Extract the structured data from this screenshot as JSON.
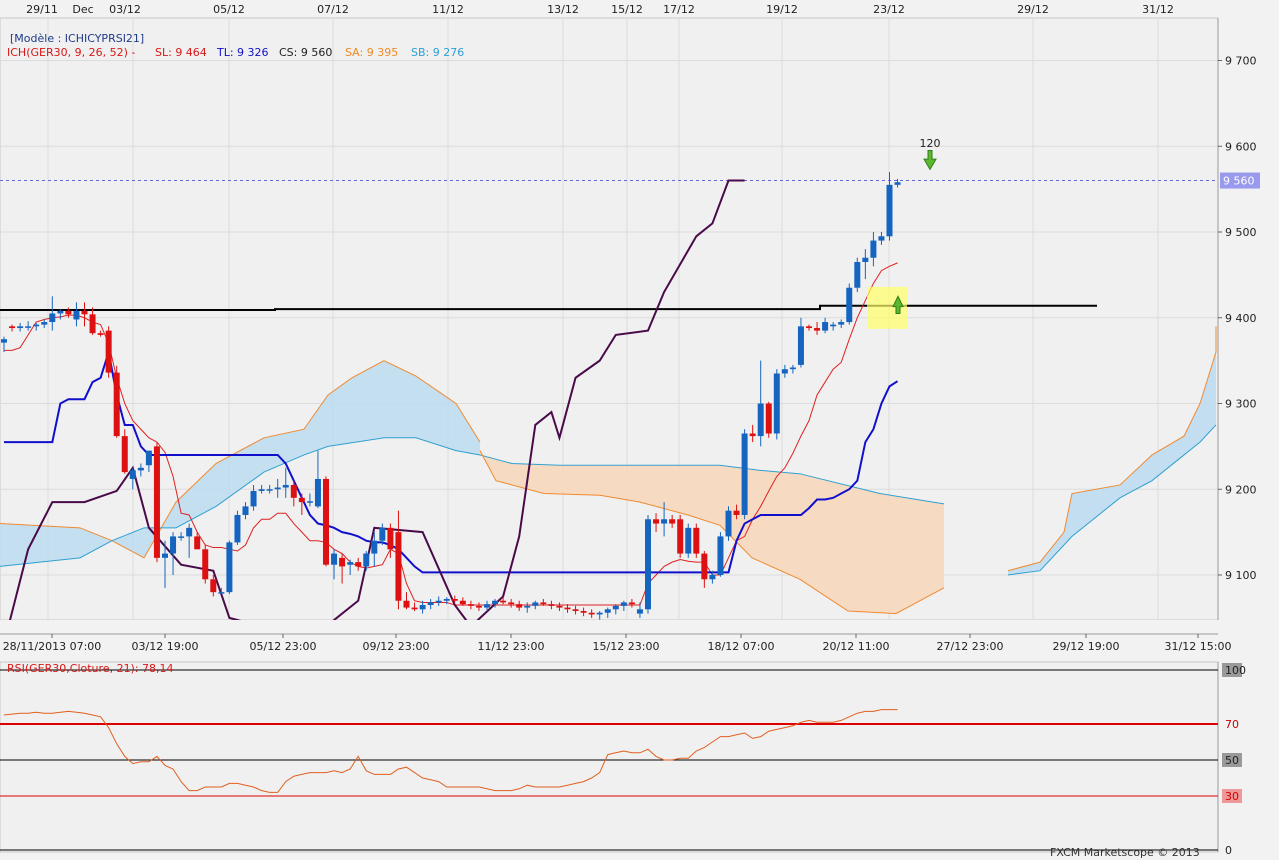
{
  "top_date_labels": [
    "29/11",
    "Dec",
    "03/12",
    "05/12",
    "07/12",
    "11/12",
    "13/12",
    "15/12",
    "17/12",
    "19/12",
    "23/12",
    "29/12",
    "31/12"
  ],
  "bottom_date_labels": [
    "28/11/2013 07:00",
    "03/12 19:00",
    "05/12 23:00",
    "09/12 23:00",
    "11/12 23:00",
    "15/12 23:00",
    "18/12 07:00",
    "20/12 11:00",
    "27/12 23:00",
    "29/12 19:00",
    "31/12 15:00"
  ],
  "legend": {
    "model": "[Modèle : ICHICYPRSI21]",
    "ich": "ICH(GER30, 9, 26, 52) -",
    "sl": "SL: 9 464",
    "tl": "TL: 9 326",
    "cs": "CS: 9 560",
    "sa": "SA: 9 395",
    "sb": "SB: 9 276"
  },
  "price_axis_ticks": [
    "9 700",
    "9 600",
    "9 500",
    "9 400",
    "9 300",
    "9 200",
    "9 100"
  ],
  "current_price_label": "9 560",
  "signal_label": "120",
  "rsi": {
    "title": "RSI(GER30,Cloture, 21): 78,14",
    "ticks": [
      "100",
      "70",
      "50",
      "30",
      "0"
    ]
  },
  "watermark": "FXCM Marketscope © 2013",
  "colors": {
    "background": "#f0f0f0",
    "candle_up": "#1565c0",
    "candle_down": "#dd1111",
    "tenkan": "#e02020",
    "kijun": "#1010cc",
    "chikou": "#4a0a4a",
    "kumo_bull_fill": "#bcdcf0",
    "kumo_bear_fill": "#f6d8bc",
    "span_a_line": "#f08a30",
    "span_b_line": "#30a0d0",
    "rsi_line": "#e06020",
    "level_70": "#dd0000",
    "current_price_bg": "#9999ee"
  },
  "chart_data": [
    {
      "type": "candlestick",
      "title": "GER30",
      "x": [
        1,
        2,
        3,
        4,
        5,
        6,
        7,
        8,
        9,
        10,
        11,
        12,
        13,
        14,
        15,
        16,
        17,
        18,
        19,
        20,
        21,
        22,
        23,
        24,
        25,
        26,
        27,
        28,
        29,
        30,
        31,
        32,
        33,
        34,
        35,
        36,
        37,
        38,
        39,
        40,
        41,
        42,
        43,
        44,
        45,
        46,
        47,
        48,
        49,
        50,
        51,
        52,
        53,
        54,
        55,
        56,
        57,
        58,
        59,
        60,
        61,
        62,
        63,
        64,
        65,
        66,
        67,
        68,
        69,
        70,
        71,
        72,
        73,
        74,
        75,
        76,
        77,
        78,
        79,
        80,
        81,
        82,
        83,
        84,
        85,
        86,
        87,
        88,
        89,
        90,
        91,
        92,
        93,
        94,
        95,
        96,
        97,
        98,
        99,
        100,
        101,
        102,
        103,
        104,
        105,
        106,
        107,
        108,
        109,
        110,
        111,
        112,
        113,
        114,
        115,
        116,
        117,
        118
      ],
      "ohlc": [
        [
          9371,
          9378,
          9360,
          9375
        ],
        [
          9390,
          9392,
          9384,
          9388
        ],
        [
          9388,
          9394,
          9384,
          9390
        ],
        [
          9390,
          9396,
          9385,
          9390
        ],
        [
          9390,
          9394,
          9385,
          9392
        ],
        [
          9392,
          9398,
          9388,
          9395
        ],
        [
          9395,
          9425,
          9385,
          9405
        ],
        [
          9405,
          9410,
          9398,
          9408
        ],
        [
          9408,
          9412,
          9400,
          9404
        ],
        [
          9398,
          9418,
          9390,
          9408
        ],
        [
          9408,
          9418,
          9390,
          9404
        ],
        [
          9404,
          9412,
          9380,
          9382
        ],
        [
          9382,
          9385,
          9378,
          9380
        ],
        [
          9385,
          9390,
          9330,
          9336
        ],
        [
          9336,
          9344,
          9260,
          9262
        ],
        [
          9262,
          9270,
          9218,
          9220
        ],
        [
          9212,
          9225,
          9200,
          9222
        ],
        [
          9222,
          9230,
          9215,
          9225
        ],
        [
          9228,
          9245,
          9220,
          9245
        ],
        [
          9250,
          9255,
          9115,
          9120
        ],
        [
          9120,
          9140,
          9085,
          9125
        ],
        [
          9125,
          9150,
          9100,
          9145
        ],
        [
          9145,
          9150,
          9140,
          9145
        ],
        [
          9145,
          9160,
          9120,
          9155
        ],
        [
          9145,
          9150,
          9130,
          9130
        ],
        [
          9130,
          9135,
          9090,
          9095
        ],
        [
          9095,
          9100,
          9075,
          9080
        ],
        [
          9080,
          9085,
          9078,
          9080
        ],
        [
          9080,
          9140,
          9078,
          9138
        ],
        [
          9138,
          9175,
          9135,
          9170
        ],
        [
          9170,
          9185,
          9165,
          9180
        ],
        [
          9180,
          9205,
          9175,
          9198
        ],
        [
          9198,
          9205,
          9195,
          9200
        ],
        [
          9200,
          9205,
          9195,
          9200
        ],
        [
          9200,
          9212,
          9190,
          9202
        ],
        [
          9202,
          9225,
          9190,
          9205
        ],
        [
          9205,
          9210,
          9180,
          9190
        ],
        [
          9190,
          9195,
          9170,
          9185
        ],
        [
          9185,
          9195,
          9180,
          9186
        ],
        [
          9180,
          9245,
          9178,
          9212
        ],
        [
          9212,
          9215,
          9110,
          9112
        ],
        [
          9112,
          9130,
          9095,
          9125
        ],
        [
          9120,
          9125,
          9090,
          9110
        ],
        [
          9112,
          9118,
          9100,
          9115
        ],
        [
          9115,
          9120,
          9105,
          9110
        ],
        [
          9110,
          9128,
          9105,
          9125
        ],
        [
          9125,
          9150,
          9110,
          9140
        ],
        [
          9140,
          9160,
          9135,
          9155
        ],
        [
          9155,
          9160,
          9120,
          9130
        ],
        [
          9150,
          9175,
          9060,
          9070
        ],
        [
          9070,
          9080,
          9060,
          9062
        ],
        [
          9062,
          9068,
          9058,
          9060
        ],
        [
          9060,
          9070,
          9055,
          9065
        ],
        [
          9065,
          9072,
          9060,
          9068
        ],
        [
          9068,
          9075,
          9064,
          9070
        ],
        [
          9070,
          9074,
          9066,
          9072
        ],
        [
          9072,
          9076,
          9068,
          9070
        ],
        [
          9070,
          9074,
          9064,
          9066
        ],
        [
          9066,
          9070,
          9060,
          9064
        ],
        [
          9064,
          9068,
          9058,
          9062
        ],
        [
          9062,
          9070,
          9058,
          9066
        ],
        [
          9066,
          9072,
          9062,
          9070
        ],
        [
          9070,
          9074,
          9066,
          9068
        ],
        [
          9068,
          9072,
          9062,
          9066
        ],
        [
          9066,
          9070,
          9058,
          9062
        ],
        [
          9062,
          9068,
          9056,
          9064
        ],
        [
          9064,
          9070,
          9060,
          9068
        ],
        [
          9068,
          9072,
          9064,
          9066
        ],
        [
          9066,
          9070,
          9060,
          9064
        ],
        [
          9064,
          9068,
          9058,
          9062
        ],
        [
          9062,
          9066,
          9056,
          9060
        ],
        [
          9060,
          9064,
          9054,
          9058
        ],
        [
          9058,
          9062,
          9052,
          9056
        ],
        [
          9056,
          9060,
          9050,
          9054
        ],
        [
          9054,
          9058,
          9048,
          9056
        ],
        [
          9056,
          9062,
          9050,
          9060
        ],
        [
          9060,
          9066,
          9054,
          9064
        ],
        [
          9064,
          9070,
          9058,
          9068
        ],
        [
          9068,
          9072,
          9062,
          9066
        ],
        [
          9055,
          9068,
          9050,
          9060
        ],
        [
          9060,
          9170,
          9055,
          9165
        ],
        [
          9165,
          9172,
          9150,
          9160
        ],
        [
          9160,
          9185,
          9145,
          9165
        ],
        [
          9165,
          9170,
          9155,
          9160
        ],
        [
          9165,
          9170,
          9120,
          9125
        ],
        [
          9125,
          9160,
          9120,
          9155
        ],
        [
          9155,
          9160,
          9120,
          9125
        ],
        [
          9125,
          9128,
          9085,
          9095
        ],
        [
          9095,
          9105,
          9090,
          9100
        ],
        [
          9100,
          9150,
          9098,
          9145
        ],
        [
          9145,
          9180,
          9140,
          9175
        ],
        [
          9175,
          9182,
          9165,
          9170
        ],
        [
          9170,
          9270,
          9165,
          9265
        ],
        [
          9265,
          9275,
          9255,
          9262
        ],
        [
          9262,
          9350,
          9250,
          9300
        ],
        [
          9300,
          9302,
          9260,
          9265
        ],
        [
          9265,
          9340,
          9258,
          9335
        ],
        [
          9335,
          9345,
          9330,
          9340
        ],
        [
          9340,
          9345,
          9335,
          9342
        ],
        [
          9345,
          9400,
          9342,
          9390
        ],
        [
          9390,
          9392,
          9385,
          9388
        ],
        [
          9388,
          9395,
          9380,
          9385
        ],
        [
          9385,
          9400,
          9382,
          9395
        ],
        [
          9390,
          9395,
          9385,
          9392
        ],
        [
          9392,
          9398,
          9388,
          9395
        ],
        [
          9395,
          9440,
          9392,
          9435
        ],
        [
          9435,
          9470,
          9430,
          9465
        ],
        [
          9465,
          9480,
          9445,
          9470
        ],
        [
          9470,
          9500,
          9460,
          9490
        ],
        [
          9490,
          9500,
          9485,
          9495
        ],
        [
          9495,
          9570,
          9490,
          9555
        ],
        [
          9555,
          9562,
          9552,
          9558
        ]
      ],
      "ylim": [
        9040,
        9760
      ],
      "series": [
        {
          "name": "SL",
          "values": [
            9362,
            9362,
            9365,
            9380,
            9395,
            9398,
            9400,
            9401,
            9403,
            9403,
            9400,
            9395,
            9392,
            9370,
            9330,
            9300,
            9280,
            9270,
            9260,
            9255,
            9243,
            9215,
            9172,
            9170,
            9150,
            9135,
            9132,
            9132,
            9130,
            9128,
            9135,
            9155,
            9165,
            9165,
            9172,
            9172,
            9160,
            9150,
            9140,
            9140,
            9138,
            9130,
            9125,
            9115,
            9110,
            9108,
            9110,
            9112,
            9130,
            9125,
            9090,
            9070,
            9068,
            9068,
            9068,
            9068,
            9065,
            9065,
            9065,
            9065,
            9065,
            9065,
            9065,
            9065,
            9065,
            9065,
            9065,
            9065,
            9065,
            9065,
            9065,
            9065,
            9065,
            9065,
            9065,
            9065,
            9065,
            9065,
            9065,
            9065,
            9090,
            9100,
            9110,
            9115,
            9118,
            9116,
            9115,
            9115,
            9100,
            9100,
            9120,
            9140,
            9145,
            9165,
            9180,
            9198,
            9215,
            9225,
            9242,
            9262,
            9280,
            9310,
            9325,
            9340,
            9348,
            9375,
            9400,
            9420,
            9440,
            9455,
            9460,
            9464
          ]
        },
        {
          "name": "TL",
          "values": [
            9255,
            9255,
            9255,
            9255,
            9255,
            9255,
            9255,
            9300,
            9305,
            9305,
            9305,
            9325,
            9330,
            9360,
            9310,
            9275,
            9275,
            9250,
            9240,
            9240,
            9240,
            9240,
            9240,
            9240,
            9240,
            9240,
            9240,
            9240,
            9240,
            9240,
            9240,
            9240,
            9240,
            9240,
            9240,
            9230,
            9210,
            9190,
            9170,
            9160,
            9158,
            9155,
            9150,
            9148,
            9145,
            9140,
            9138,
            9138,
            9135,
            9130,
            9120,
            9110,
            9103,
            9103,
            9103,
            9103,
            9103,
            9103,
            9103,
            9103,
            9103,
            9103,
            9103,
            9103,
            9103,
            9103,
            9103,
            9103,
            9103,
            9103,
            9103,
            9103,
            9103,
            9103,
            9103,
            9103,
            9103,
            9103,
            9103,
            9103,
            9103,
            9103,
            9103,
            9103,
            9103,
            9103,
            9103,
            9103,
            9103,
            9103,
            9103,
            9140,
            9160,
            9165,
            9170,
            9170,
            9170,
            9170,
            9170,
            9170,
            9178,
            9188,
            9188,
            9190,
            9195,
            9200,
            9210,
            9255,
            9270,
            9300,
            9320,
            9326
          ]
        }
      ]
    },
    {
      "type": "line",
      "title": "RSI(GER30,Cloture, 21): 78,14",
      "ylim": [
        0,
        100
      ],
      "levels": [
        70,
        50,
        30
      ],
      "series": [
        {
          "name": "RSI",
          "values": [
            75,
            75.5,
            76,
            76,
            76.5,
            76,
            76,
            76.5,
            77,
            76.5,
            76,
            75,
            74,
            68,
            59,
            52,
            48,
            49,
            49,
            52,
            47,
            45,
            38,
            33,
            33,
            35,
            35,
            35,
            37,
            37,
            36,
            35,
            33,
            32,
            32,
            38,
            41,
            42,
            43,
            43,
            43,
            44,
            43,
            45,
            52,
            44,
            42,
            42,
            42,
            45,
            46,
            43,
            40,
            39,
            38,
            35,
            35,
            35,
            35,
            35,
            34,
            33,
            33,
            33,
            34,
            36,
            35,
            35,
            35,
            35,
            36,
            37,
            38,
            40,
            43,
            53,
            54,
            55,
            54,
            54,
            56,
            52,
            50,
            50,
            51,
            51,
            55,
            57,
            60,
            63,
            63,
            64,
            65,
            62,
            63,
            66,
            67,
            68,
            69,
            71,
            72,
            71,
            71,
            71,
            72,
            74,
            76,
            77,
            77,
            78,
            78,
            78
          ]
        }
      ]
    }
  ]
}
